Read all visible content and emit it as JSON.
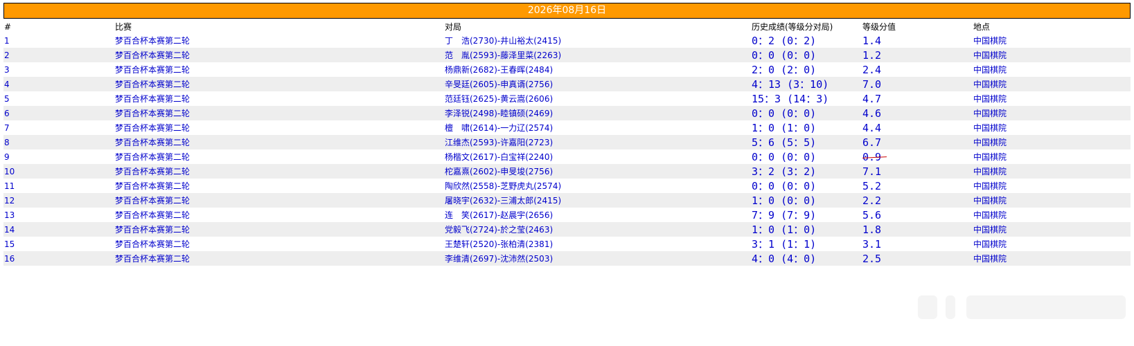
{
  "header": {
    "date": "2026年08月16日"
  },
  "columns": {
    "num": "#",
    "match": "比赛",
    "game": "对局",
    "history": "历史成绩(等级分对局)",
    "rating": "等级分值",
    "venue": "地点"
  },
  "rows": [
    {
      "num": "1",
      "match": "梦百合杯本赛第二轮",
      "game": "丁　浩(2730)-井山裕太(2415)",
      "history": "0：2 (0：2)",
      "rating": "1.4",
      "venue": "中国棋院"
    },
    {
      "num": "2",
      "match": "梦百合杯本赛第二轮",
      "game": "范　胤(2593)-藤泽里菜(2263)",
      "history": "0：0 (0：0)",
      "rating": "1.2",
      "venue": "中国棋院"
    },
    {
      "num": "3",
      "match": "梦百合杯本赛第二轮",
      "game": "杨鼎新(2682)-王春晖(2484)",
      "history": "2：0 (2：0)",
      "rating": "2.4",
      "venue": "中国棋院"
    },
    {
      "num": "4",
      "match": "梦百合杯本赛第二轮",
      "game": "辛旻廷(2605)-申真谞(2756)",
      "history": "4：13 (3：10)",
      "rating": "7.0",
      "venue": "中国棋院"
    },
    {
      "num": "5",
      "match": "梦百合杯本赛第二轮",
      "game": "范廷钰(2625)-黄云嵩(2606)",
      "history": "15：3 (14：3)",
      "rating": "4.7",
      "venue": "中国棋院"
    },
    {
      "num": "6",
      "match": "梦百合杯本赛第二轮",
      "game": "李泽锐(2498)-睦镇硕(2469)",
      "history": "0：0 (0：0)",
      "rating": "4.6",
      "venue": "中国棋院"
    },
    {
      "num": "7",
      "match": "梦百合杯本赛第二轮",
      "game": "檀　啸(2614)-一力辽(2574)",
      "history": "1：0 (1：0)",
      "rating": "4.4",
      "venue": "中国棋院"
    },
    {
      "num": "8",
      "match": "梦百合杯本赛第二轮",
      "game": "江维杰(2593)-许嘉阳(2723)",
      "history": "5：6 (5：5)",
      "rating": "6.7",
      "venue": "中国棋院"
    },
    {
      "num": "9",
      "match": "梦百合杯本赛第二轮",
      "game": "杨楷文(2617)-白宝祥(2240)",
      "history": "0：0 (0：0)",
      "rating": "0.9",
      "venue": "中国棋院"
    },
    {
      "num": "10",
      "match": "梦百合杯本赛第二轮",
      "game": "柁嘉熹(2602)-申旻埈(2756)",
      "history": "3：2 (3：2)",
      "rating": "7.1",
      "venue": "中国棋院"
    },
    {
      "num": "11",
      "match": "梦百合杯本赛第二轮",
      "game": "陶欣然(2558)-芝野虎丸(2574)",
      "history": "0：0 (0：0)",
      "rating": "5.2",
      "venue": "中国棋院"
    },
    {
      "num": "12",
      "match": "梦百合杯本赛第二轮",
      "game": "屠晓宇(2632)-三浦太郎(2415)",
      "history": "1：0 (0：0)",
      "rating": "2.2",
      "venue": "中国棋院"
    },
    {
      "num": "13",
      "match": "梦百合杯本赛第二轮",
      "game": "连　笑(2617)-赵晨宇(2656)",
      "history": "7：9 (7：9)",
      "rating": "5.6",
      "venue": "中国棋院"
    },
    {
      "num": "14",
      "match": "梦百合杯本赛第二轮",
      "game": "党毅飞(2724)-於之莹(2463)",
      "history": "1：0 (1：0)",
      "rating": "1.8",
      "venue": "中国棋院"
    },
    {
      "num": "15",
      "match": "梦百合杯本赛第二轮",
      "game": "王楚轩(2520)-张柏清(2381)",
      "history": "3：1 (1：1)",
      "rating": "3.1",
      "venue": "中国棋院"
    },
    {
      "num": "16",
      "match": "梦百合杯本赛第二轮",
      "game": "李维清(2697)-沈沛然(2503)",
      "history": "4：0 (4：0)",
      "rating": "2.5",
      "venue": "中国棋院"
    }
  ],
  "colors": {
    "header_bg": "#ff9900",
    "link": "#0000cc",
    "row_alt": "#eeeeee",
    "strike": "#cc0000"
  }
}
